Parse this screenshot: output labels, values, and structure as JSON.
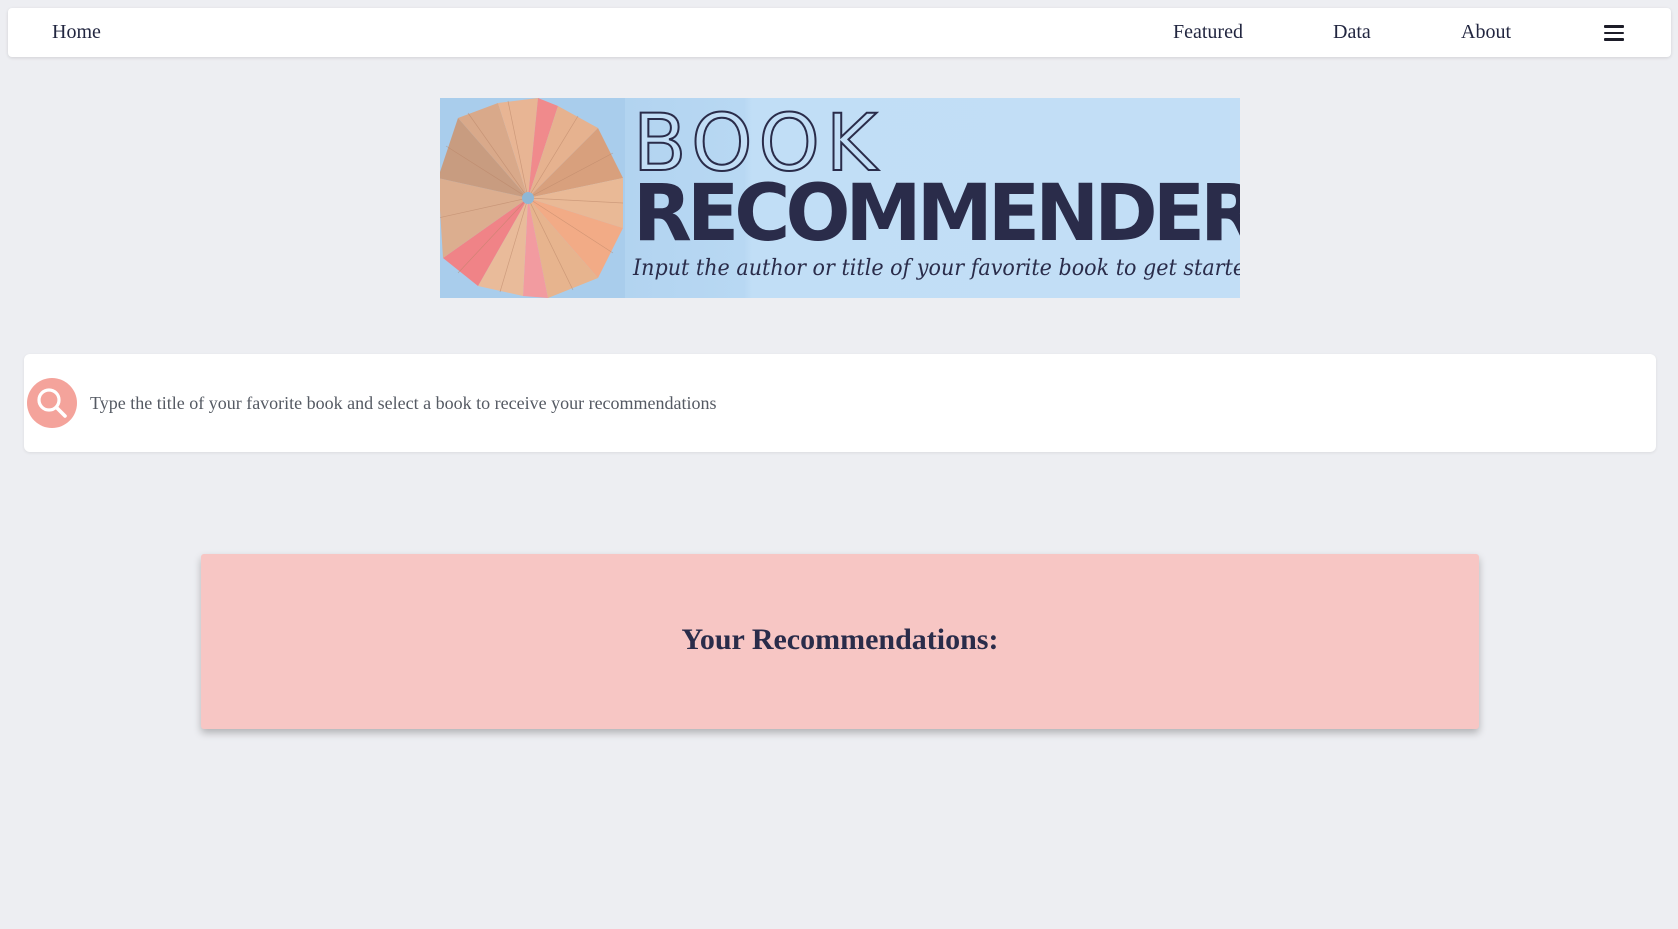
{
  "navbar": {
    "home_label": "Home",
    "links": [
      {
        "label": "Featured"
      },
      {
        "label": "Data"
      },
      {
        "label": "About"
      }
    ],
    "menu_icon": "hamburger-menu-icon"
  },
  "banner": {
    "title_line1": "BOOK",
    "title_line2": "RECOMMENDER",
    "subtitle": "Input the author or title of your favorite book to get started!",
    "colors": {
      "background": "#c2def6",
      "text": "#2a2c4a"
    }
  },
  "search": {
    "icon": "search-icon",
    "placeholder": "Type the title of your favorite book and select a book to receive your recommendations",
    "value": "",
    "icon_color": "#f4a39b"
  },
  "recommendations": {
    "title": "Your Recommendations:",
    "background": "#f7c6c4"
  }
}
